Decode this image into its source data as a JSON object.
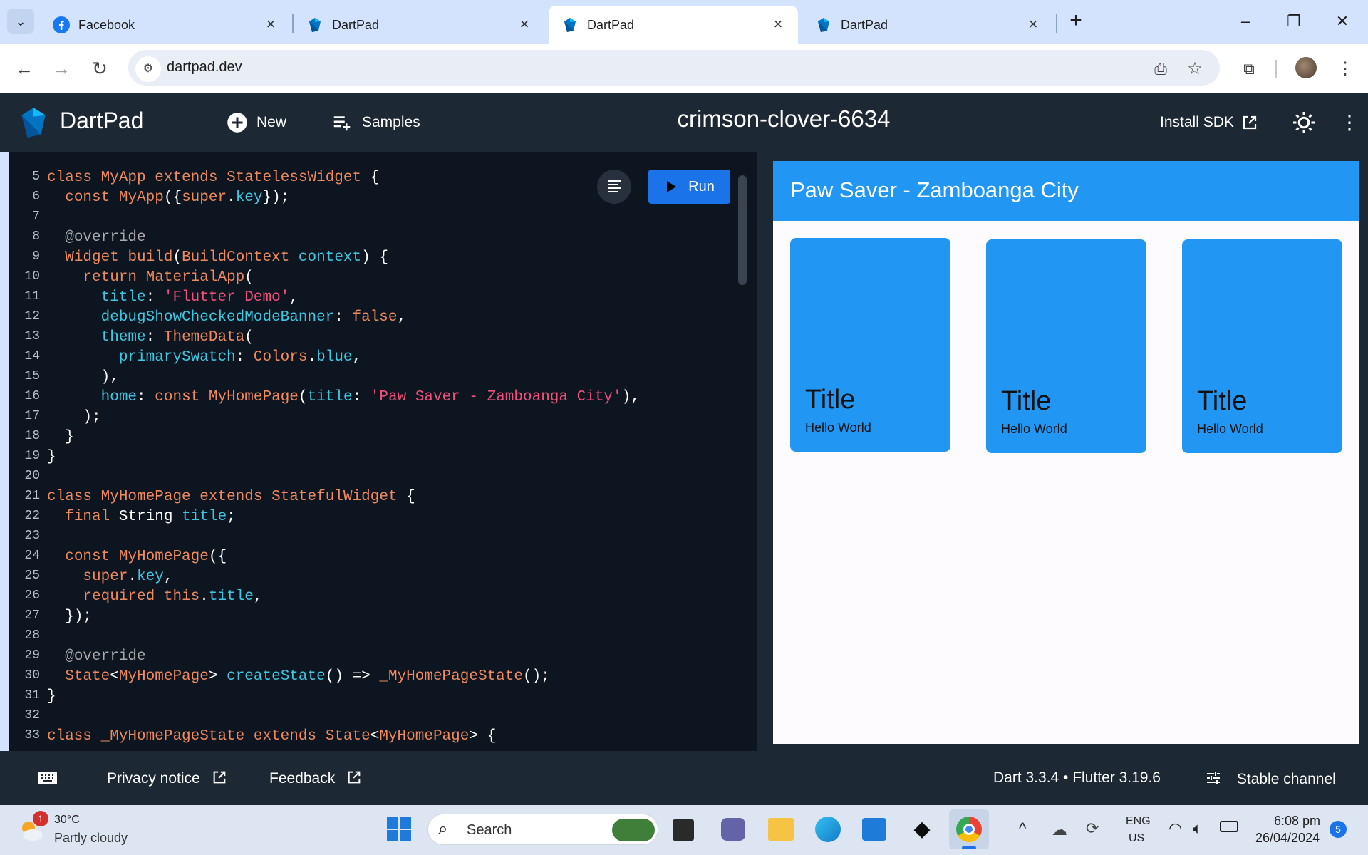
{
  "browser": {
    "tabs": [
      {
        "title": "Facebook",
        "active": false
      },
      {
        "title": "DartPad",
        "active": false
      },
      {
        "title": "DartPad",
        "active": true
      },
      {
        "title": "DartPad",
        "active": false
      }
    ],
    "url": "dartpad.dev"
  },
  "dartpad": {
    "app_name": "DartPad",
    "new_label": "New",
    "samples_label": "Samples",
    "project_name": "crimson-clover-6634",
    "install_sdk_label": "Install SDK",
    "run_label": "Run"
  },
  "code_lines": [
    {
      "n": "5"
    },
    {
      "n": "6"
    },
    {
      "n": "7"
    },
    {
      "n": "8"
    },
    {
      "n": "9"
    },
    {
      "n": "10"
    },
    {
      "n": "11"
    },
    {
      "n": "12"
    },
    {
      "n": "13"
    },
    {
      "n": "14"
    },
    {
      "n": "15"
    },
    {
      "n": "16"
    },
    {
      "n": "17"
    },
    {
      "n": "18"
    },
    {
      "n": "19"
    },
    {
      "n": "20"
    },
    {
      "n": "21"
    },
    {
      "n": "22"
    },
    {
      "n": "23"
    },
    {
      "n": "24"
    },
    {
      "n": "25"
    },
    {
      "n": "26"
    },
    {
      "n": "27"
    },
    {
      "n": "28"
    },
    {
      "n": "29"
    },
    {
      "n": "30"
    },
    {
      "n": "31"
    },
    {
      "n": "32"
    },
    {
      "n": "33"
    }
  ],
  "code": {
    "l5": [
      "class",
      "MyApp",
      "extends",
      "StatelessWidget",
      "{"
    ],
    "l6": [
      "const",
      "MyApp",
      "({",
      "super",
      ".",
      "key",
      "});"
    ],
    "l8": "@override",
    "l9": [
      "Widget",
      "build",
      "(",
      "BuildContext",
      "context",
      ") {"
    ],
    "l10": [
      "return",
      "MaterialApp",
      "("
    ],
    "l11": [
      "title",
      ": ",
      "'Flutter Demo'",
      ","
    ],
    "l12": [
      "debugShowCheckedModeBanner",
      ": ",
      "false",
      ","
    ],
    "l13": [
      "theme",
      ": ",
      "ThemeData",
      "("
    ],
    "l14": [
      "primarySwatch",
      ": ",
      "Colors",
      ".",
      "blue",
      ","
    ],
    "l15": "),",
    "l16": [
      "home",
      ": ",
      "const",
      "MyHomePage",
      "(",
      "title",
      ": ",
      "'Paw Saver - Zamboanga City'",
      "),"
    ],
    "l17": ");",
    "l18": "}",
    "l19": "}",
    "l21": [
      "class",
      "MyHomePage",
      "extends",
      "StatefulWidget",
      "{"
    ],
    "l22": [
      "final",
      "String",
      "title",
      ";"
    ],
    "l24": [
      "const",
      "MyHomePage",
      "({"
    ],
    "l25": [
      "super",
      ".",
      "key",
      ","
    ],
    "l26": [
      "required",
      "this",
      ".",
      "title",
      ","
    ],
    "l27": "});",
    "l29": "@override",
    "l30": [
      "State",
      "<",
      "MyHomePage",
      ">",
      "createState",
      "() => ",
      "_MyHomePageState",
      "();"
    ],
    "l31": "}",
    "l33": [
      "class",
      "_MyHomePageState",
      "extends",
      "State",
      "<",
      "MyHomePage",
      ">",
      "{"
    ]
  },
  "preview": {
    "appbar_title": "Paw Saver - Zamboanga City",
    "cards": [
      {
        "title": "Title",
        "subtitle": "Hello World"
      },
      {
        "title": "Title",
        "subtitle": "Hello World"
      },
      {
        "title": "Title",
        "subtitle": "Hello World"
      }
    ]
  },
  "footer": {
    "privacy": "Privacy notice",
    "feedback": "Feedback",
    "version": "Dart 3.3.4 • Flutter 3.19.6",
    "channel": "Stable channel"
  },
  "taskbar": {
    "weather_temp": "30°C",
    "weather_desc": "Partly cloudy",
    "weather_badge": "1",
    "search_placeholder": "Search",
    "lang_top": "ENG",
    "lang_bottom": "US",
    "time": "6:08 pm",
    "date": "26/04/2024",
    "notif_count": "5"
  },
  "colors": {
    "accent": "#1a73e8",
    "flutter_blue": "#2196f3",
    "dartpad_bg": "#1c2834",
    "editor_bg": "#0d1520"
  },
  "icons": [
    "facebook-icon",
    "dart-icon",
    "add-circle-icon",
    "playlist-add-icon",
    "open-in-new-icon",
    "brightness-icon",
    "more-vert-icon",
    "play-icon",
    "format-icon",
    "keyboard-icon",
    "tune-icon"
  ]
}
